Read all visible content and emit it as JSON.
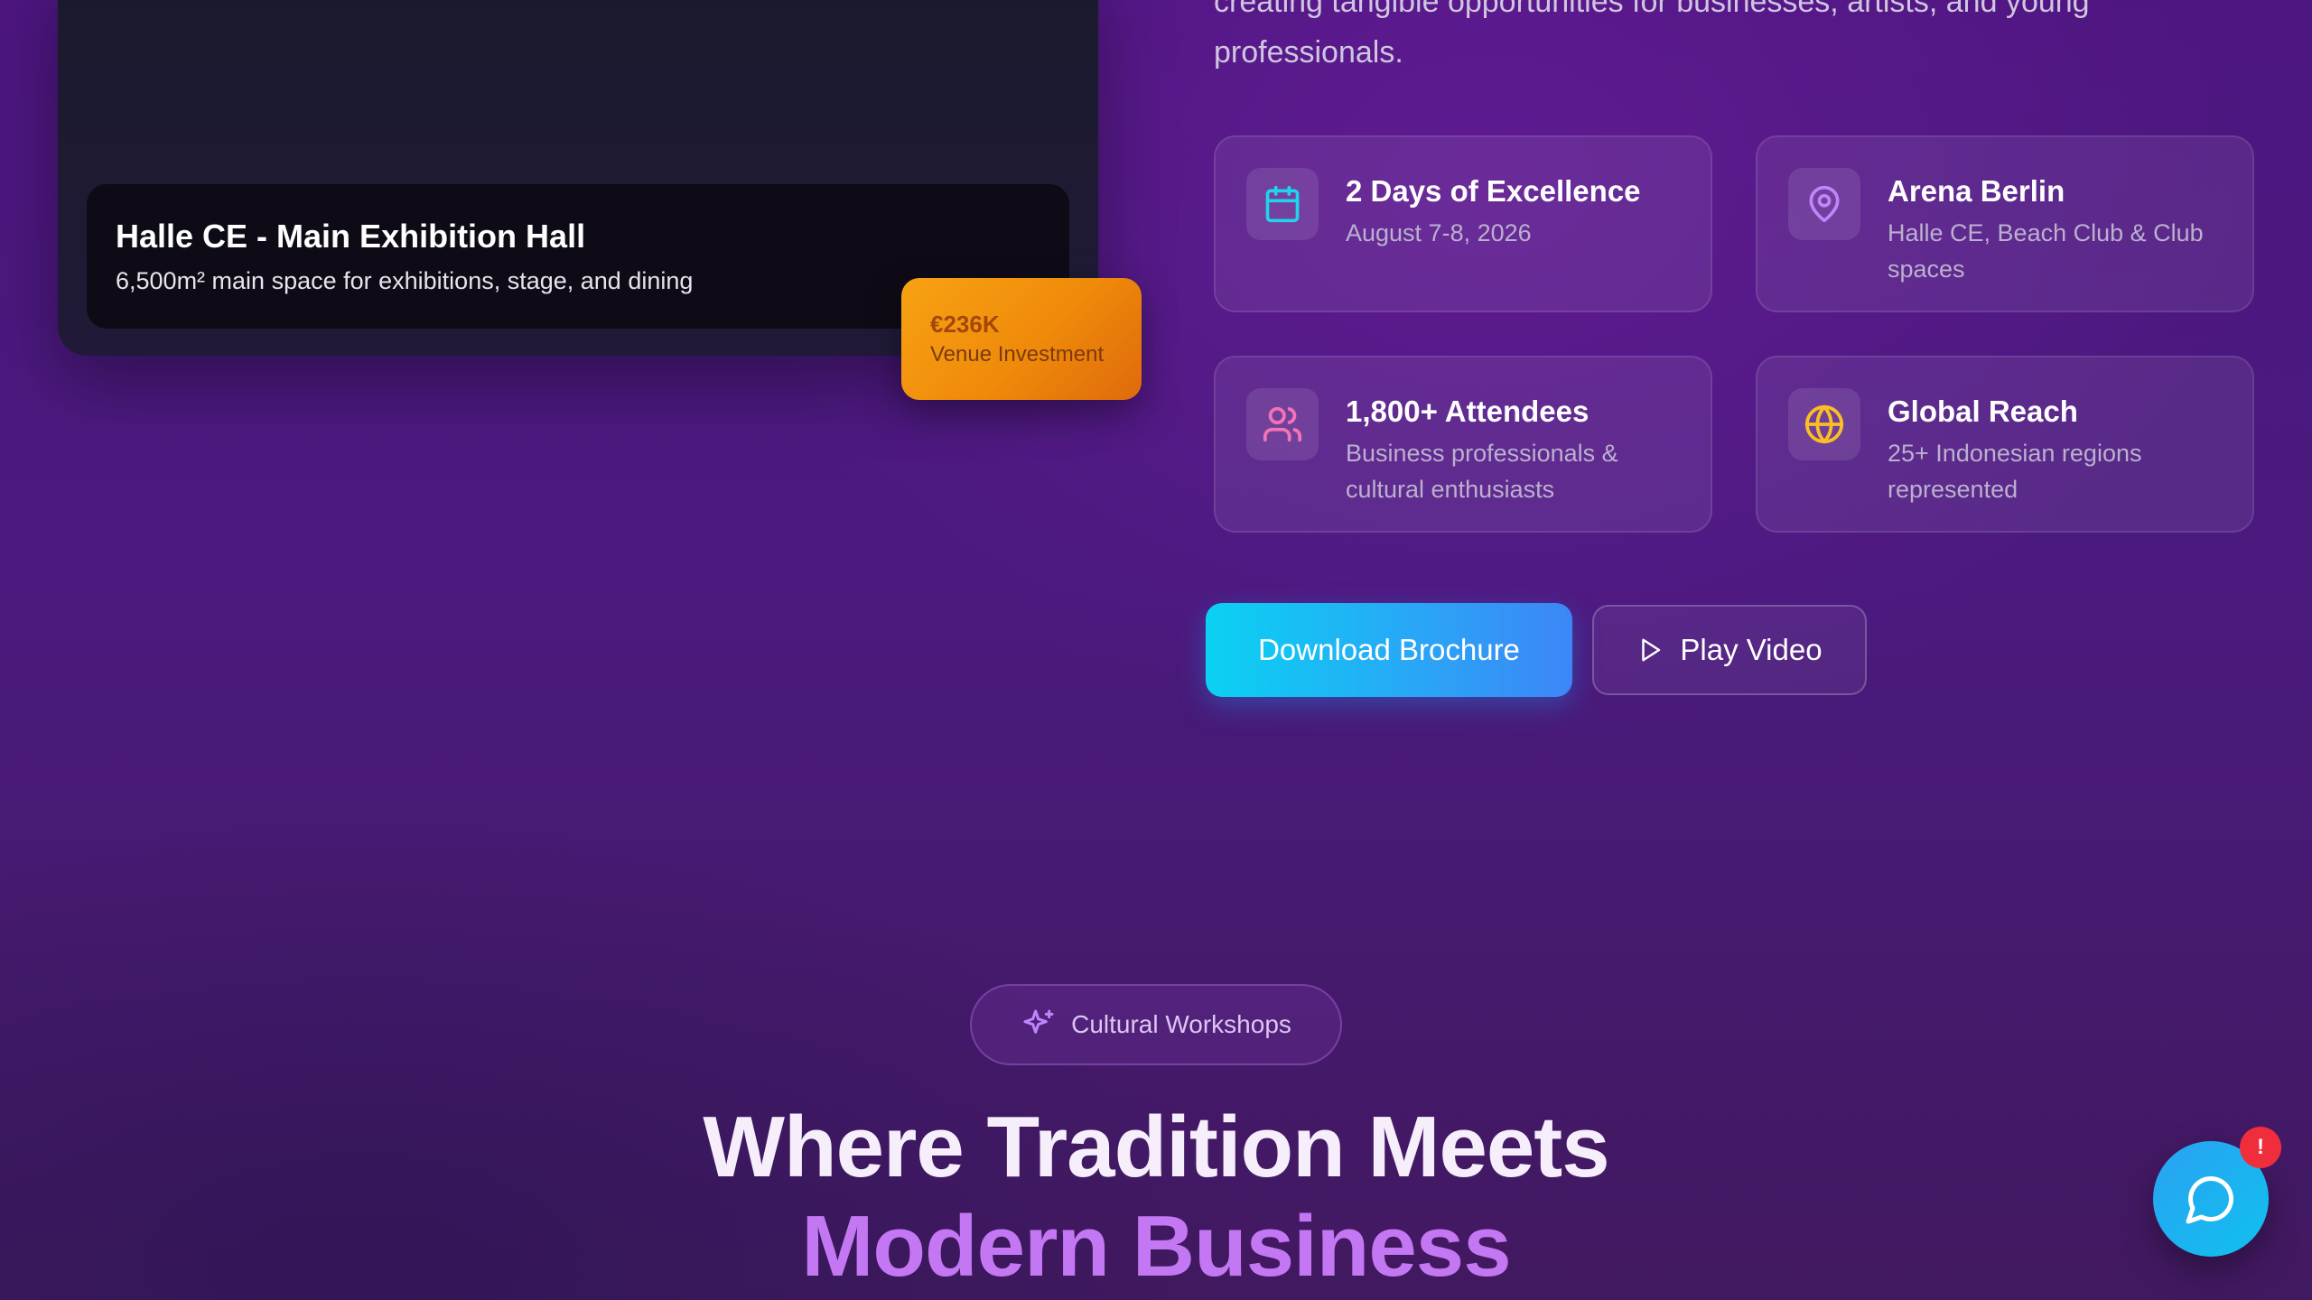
{
  "intro": {
    "text": "creating tangible opportunities for businesses, artists, and young professionals."
  },
  "venue_card": {
    "title": "Halle CE - Main Exhibition Hall",
    "subtitle": "6,500m² main space for exhibitions, stage, and dining",
    "badge_value": "€236K",
    "badge_label": "Venue Investment"
  },
  "stats": [
    {
      "icon": "calendar-icon",
      "title": "2 Days of Excellence",
      "desc": "August 7-8, 2026",
      "color": "#22d3ee"
    },
    {
      "icon": "map-pin-icon",
      "title": "Arena Berlin",
      "desc": "Halle CE, Beach Club & Club spaces",
      "color": "#c084fc"
    },
    {
      "icon": "users-icon",
      "title": "1,800+ Attendees",
      "desc": "Business professionals & cultural enthusiasts",
      "color": "#f472b6"
    },
    {
      "icon": "globe-icon",
      "title": "Global Reach",
      "desc": "25+ Indonesian regions represented",
      "color": "#fbbf24"
    }
  ],
  "actions": {
    "download_label": "Download Brochure",
    "video_label": "Play Video"
  },
  "section": {
    "pill_label": "Cultural Workshops",
    "headline_1": "Where Tradition Meets",
    "headline_2": "Modern Business"
  },
  "chat": {
    "badge": "!"
  }
}
